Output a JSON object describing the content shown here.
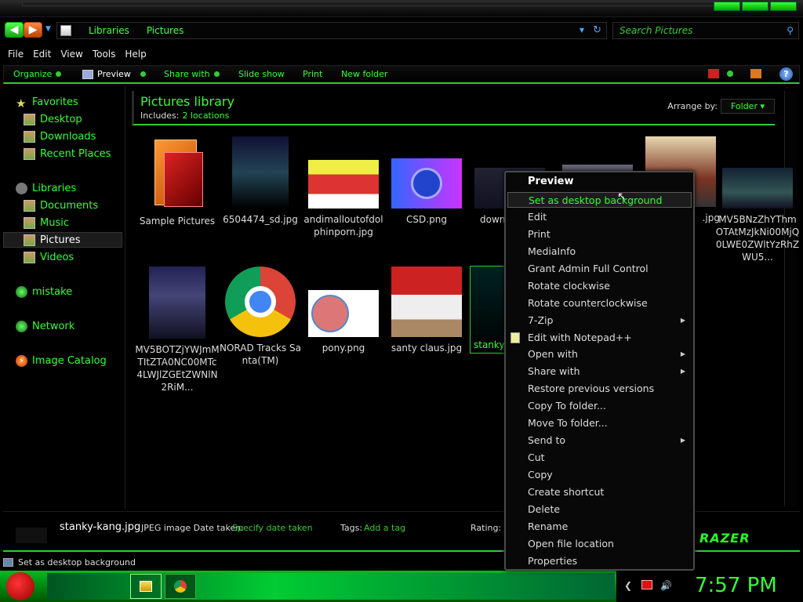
{
  "address": {
    "crumbs": [
      "Libraries",
      "Pictures"
    ]
  },
  "search": {
    "placeholder": "Search Pictures"
  },
  "menu": [
    "File",
    "Edit",
    "View",
    "Tools",
    "Help"
  ],
  "commands": {
    "organize": "Organize",
    "preview": "Preview",
    "share": "Share with",
    "slideshow": "Slide show",
    "print": "Print",
    "newfolder": "New folder"
  },
  "sidebar": {
    "favorites": "Favorites",
    "desktop": "Desktop",
    "downloads": "Downloads",
    "recent": "Recent Places",
    "libraries": "Libraries",
    "documents": "Documents",
    "music": "Music",
    "pictures": "Pictures",
    "videos": "Videos",
    "mistake": "mistake",
    "network": "Network",
    "catalog": "Image Catalog"
  },
  "library": {
    "title": "Pictures library",
    "includes_label": "Includes:",
    "locations": "2 locations",
    "arrange_label": "Arrange by:",
    "arrange_value": "Folder"
  },
  "thumbs": {
    "t1": "Sample Pictures",
    "t2": "6504474_sd.jpg",
    "t3": "andimalloutofdolphinporn.jpg",
    "t4": "CSD.png",
    "t5": "down",
    "t7": ".jpg",
    "t8": "MV5BNzZhYThmOTAtMzJkNi00MjQ0LWE0ZWltYzRhZWU5...",
    "t9": "MV5BOTZjYWJmMTItZTA0NC00MTc4LWJlZGEtZWNlN2RiM...",
    "t10": "NORAD Tracks Santa(TM)",
    "t11": "pony.png",
    "t12": "santy claus.jpg",
    "t13": "stanky"
  },
  "details": {
    "name": "stanky-kang.jpg",
    "type": "JPEG image",
    "date_label": "Date taken:",
    "date_link": "Specify date taken",
    "tags_label": "Tags:",
    "tags_link": "Add a tag",
    "rating_label": "Rating:"
  },
  "status": {
    "text": "Set as desktop background"
  },
  "clock": "7:57 PM",
  "context_menu": {
    "header": "Preview",
    "items": [
      "Set as desktop background",
      "Edit",
      "Print",
      "MediaInfo",
      "Grant Admin Full Control",
      "Rotate clockwise",
      "Rotate counterclockwise",
      "7-Zip",
      "Edit with Notepad++",
      "Open with",
      "Share with",
      "Restore previous versions",
      "Copy To folder...",
      "Move To folder...",
      "Send to",
      "Cut",
      "Copy",
      "Create shortcut",
      "Delete",
      "Rename",
      "Open file location",
      "Properties"
    ]
  },
  "logo_text": "RAZER"
}
